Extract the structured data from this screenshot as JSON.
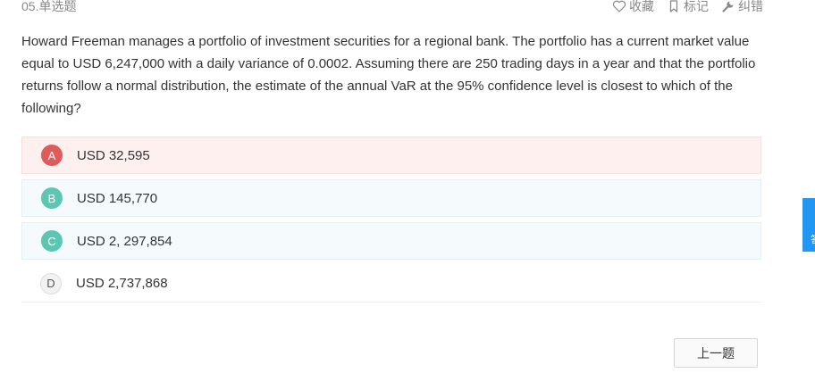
{
  "question": {
    "number_label": "05.单选题",
    "stem": "Howard Freeman manages a portfolio of investment securities for a regional bank. The portfolio has a current market value equal to USD 6,247,000 with a daily variance of 0.0002. Assuming there are 250 trading days in a year and that the portfolio returns follow a normal distribution, the estimate of the annual VaR at the 95% confidence level is closest to which of the following?"
  },
  "actions": {
    "favorite_label": "收藏",
    "mark_label": "标记",
    "report_label": "纠错"
  },
  "options": [
    {
      "letter": "A",
      "text": "USD 32,595"
    },
    {
      "letter": "B",
      "text": "USD 145,770"
    },
    {
      "letter": "C",
      "text": "USD 2, 297,854"
    },
    {
      "letter": "D",
      "text": "USD 2,737,868"
    }
  ],
  "navigation": {
    "prev_label": "上一题"
  },
  "side_tab": {
    "label": "答"
  },
  "colors": {
    "selected_wrong_bg": "#fdf0ef",
    "option_bg": "#f5fbfd",
    "badge_red": "#e05a5a",
    "badge_teal": "#5cc6b4",
    "side_tab": "#2196f3"
  }
}
